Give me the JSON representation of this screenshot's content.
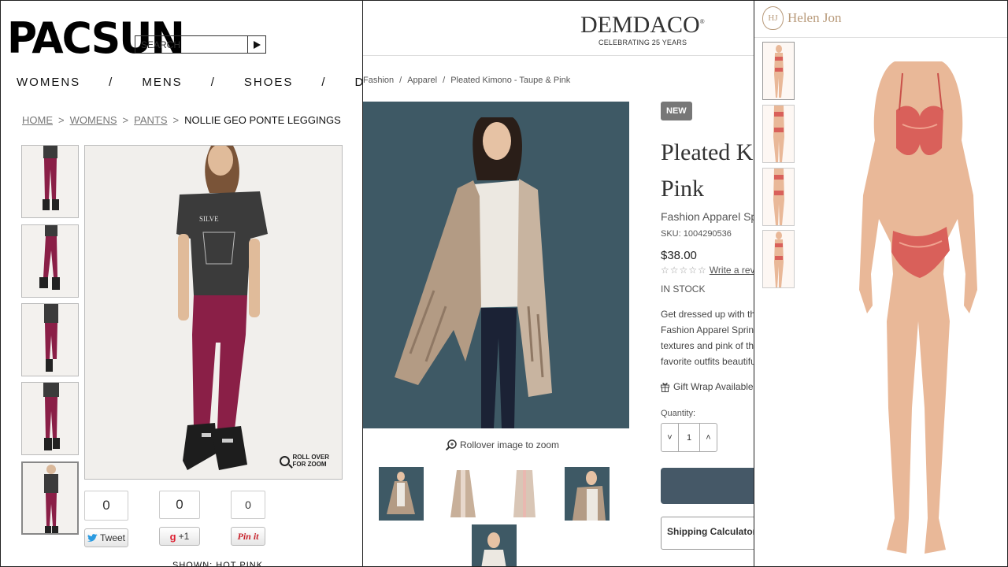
{
  "pacsun": {
    "logo": "PACSUN",
    "search_placeholder": "SEARCH",
    "nav": [
      "WOMENS",
      "/",
      "MENS",
      "/",
      "SHOES",
      "/",
      "DENIM"
    ],
    "breadcrumb": {
      "home": "HOME",
      "womens": "WOMENS",
      "pants": "PANTS",
      "sep": ">",
      "current": "NOLLIE GEO PONTE LEGGINGS"
    },
    "zoom_hint_line1": "ROLL OVER",
    "zoom_hint_line2": "FOR ZOOM",
    "share": {
      "twitter_count": "0",
      "twitter_label": "Tweet",
      "gplus_count": "0",
      "gplus_label": "+1",
      "pin_count": "0",
      "pin_label": "Pin it"
    },
    "shown_text": "SHOWN: HOT PINK",
    "colors": {
      "legging": "#8a1f47",
      "shirt": "#3b3b3b"
    }
  },
  "demdaco": {
    "logo": "DEMDACO",
    "tagline": "CELEBRATING 25 YEARS",
    "breadcrumb": [
      "Fashion",
      "Apparel",
      "Pleated Kimono - Taupe & Pink"
    ],
    "breadcrumb_sep": "/",
    "zoom_hint": "Rollover image to zoom",
    "badge": "NEW",
    "title_line1": "Pleated K",
    "title_line2": "Pink",
    "subtitle": "Fashion Apparel Spring",
    "sku": "SKU: 1004290536",
    "price": "$38.00",
    "stars": "☆☆☆☆☆",
    "review_link": "Write a revi",
    "stock": "IN STOCK",
    "description": [
      "Get dressed up with the",
      "Fashion Apparel Spring/",
      "textures and pink of this",
      "favorite outfits beautifully"
    ],
    "gift_wrap": "Gift Wrap Available In",
    "quantity_label": "Quantity:",
    "quantity_value": "1",
    "qty_minus": "˅",
    "qty_plus": "˄",
    "shipping_calculator": "Shipping Calculator",
    "colors": {
      "backdrop": "#3e5965",
      "button": "#455867"
    }
  },
  "helenjon": {
    "logo": "Helen Jon",
    "monogram": "HJ",
    "colors": {
      "swim": "#d9605a",
      "skin": "#e9b898"
    }
  }
}
